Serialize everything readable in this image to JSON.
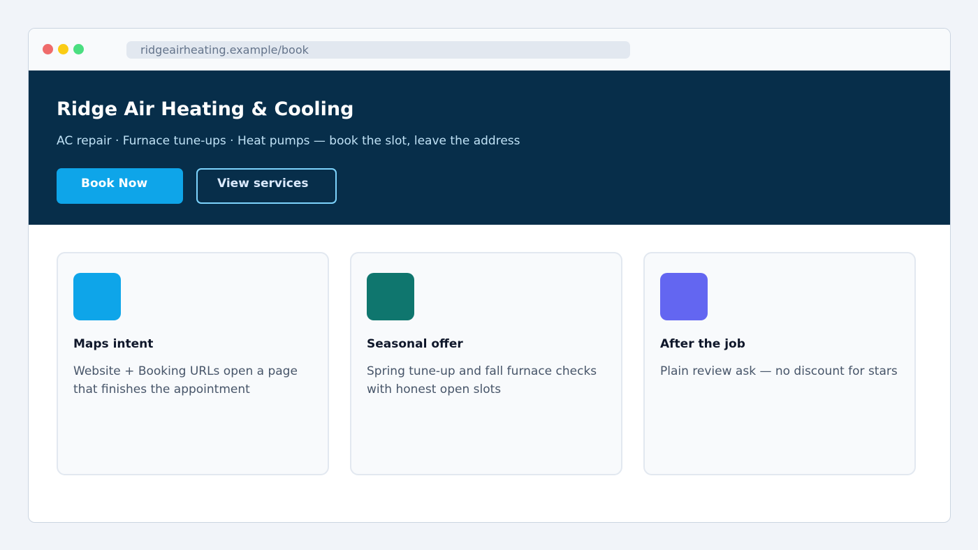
{
  "browser": {
    "url": "ridgeairheating.example/book"
  },
  "hero": {
    "title": "Ridge Air Heating & Cooling",
    "subtitle": "AC repair · Furnace tune-ups · Heat pumps — book the slot, leave the address",
    "primary_button": "Book Now",
    "secondary_button": "View services"
  },
  "cards": [
    {
      "title": "Maps intent",
      "text": "Website + Booking URLs open a page that finishes the appointment",
      "color": "#0ea5e9"
    },
    {
      "title": "Seasonal offer",
      "text": "Spring tune-up and fall furnace checks with honest open slots",
      "color": "#0f766e"
    },
    {
      "title": "After the job",
      "text": "Plain review ask — no discount for stars",
      "color": "#6366f1"
    }
  ],
  "colors": {
    "hero_bg": "#072e4a",
    "accent": "#0ea5e9",
    "page_bg": "#f1f4f9"
  }
}
